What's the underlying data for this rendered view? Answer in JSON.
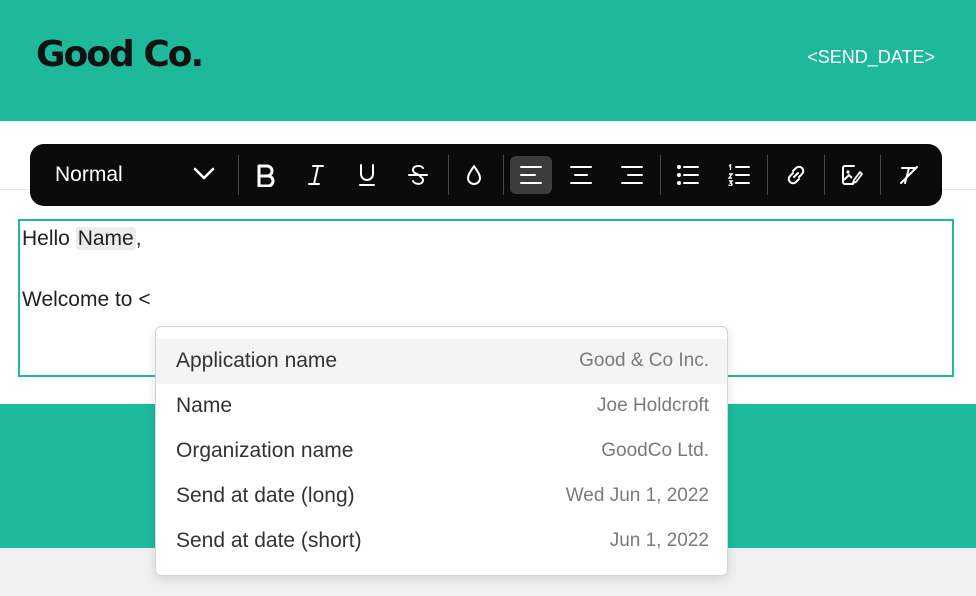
{
  "header": {
    "logo": "Good Co.",
    "send_date_placeholder": "<SEND_DATE>"
  },
  "toolbar": {
    "format_select": {
      "value": "Normal"
    },
    "buttons": [
      "bold",
      "italic",
      "underline",
      "strikethrough",
      "text-color",
      "align-left",
      "align-center",
      "align-right",
      "bulleted-list",
      "numbered-list",
      "link",
      "image-edit",
      "clear-formatting"
    ],
    "active": "align-left"
  },
  "editor": {
    "line1_prefix": "Hello ",
    "line1_token": "Name",
    "line1_suffix": ",",
    "line2": "Welcome to <"
  },
  "popup": {
    "items": [
      {
        "label": "Application name",
        "value": "Good & Co Inc."
      },
      {
        "label": "Name",
        "value": "Joe Holdcroft"
      },
      {
        "label": "Organization name",
        "value": "GoodCo Ltd."
      },
      {
        "label": "Send at date (long)",
        "value": "Wed Jun 1, 2022"
      },
      {
        "label": "Send at date (short)",
        "value": "Jun 1, 2022"
      }
    ]
  },
  "colors": {
    "brand_green": "#1eb99b",
    "toolbar_bg": "#0b0b0b"
  }
}
